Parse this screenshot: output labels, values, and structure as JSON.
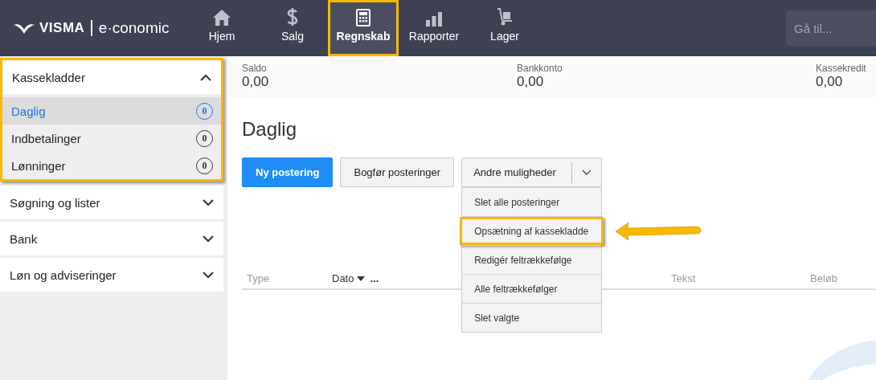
{
  "header": {
    "logo": {
      "brand": "VISMA",
      "product": "e·conomic"
    },
    "nav": [
      {
        "label": "Hjem",
        "selected": false,
        "highlighted": false
      },
      {
        "label": "Salg",
        "selected": false,
        "highlighted": false
      },
      {
        "label": "Regnskab",
        "selected": true,
        "highlighted": true
      },
      {
        "label": "Rapporter",
        "selected": false,
        "highlighted": false
      },
      {
        "label": "Lager",
        "selected": false,
        "highlighted": false
      }
    ],
    "search": {
      "placeholder": "Gå til..."
    }
  },
  "sidebar": {
    "sections": [
      {
        "label": "Kassekladder",
        "expanded": true,
        "highlighted": true,
        "children": [
          {
            "label": "Daglig",
            "count": "0",
            "selected": true
          },
          {
            "label": "Indbetalinger",
            "count": "0",
            "selected": false
          },
          {
            "label": "Lønninger",
            "count": "0",
            "selected": false
          }
        ]
      },
      {
        "label": "Søgning og lister",
        "expanded": false,
        "highlighted": false
      },
      {
        "label": "Bank",
        "expanded": false,
        "highlighted": false
      },
      {
        "label": "Løn og adviseringer",
        "expanded": false,
        "highlighted": false
      }
    ]
  },
  "summary": [
    {
      "label": "Saldo",
      "value": "0,00"
    },
    {
      "label": "Bankkonto",
      "value": "0,00"
    },
    {
      "label": "Kassekredit",
      "value": "0,00"
    }
  ],
  "title": "Daglig",
  "toolbar": {
    "primary": "Ny postering",
    "secondary": "Bogfør posteringer",
    "dropdown": {
      "label": "Andre muligheder",
      "expanded": true,
      "items": [
        {
          "label": "Slet alle posteringer",
          "highlighted": false
        },
        {
          "label": "Opsætning af kassekladde",
          "highlighted": true
        },
        {
          "label": "Redigér feltrækkefølge",
          "highlighted": false
        },
        {
          "label": "Alle feltrækkefølger",
          "highlighted": false
        },
        {
          "label": "Slet valgte",
          "highlighted": false
        }
      ]
    }
  },
  "table": {
    "columns": [
      {
        "label": "Type",
        "sorted": false
      },
      {
        "label": "Dato",
        "sorted": true,
        "more": "..."
      },
      {
        "label": "Tekst",
        "sorted": false
      },
      {
        "label": "Beløb",
        "sorted": false
      }
    ]
  }
}
